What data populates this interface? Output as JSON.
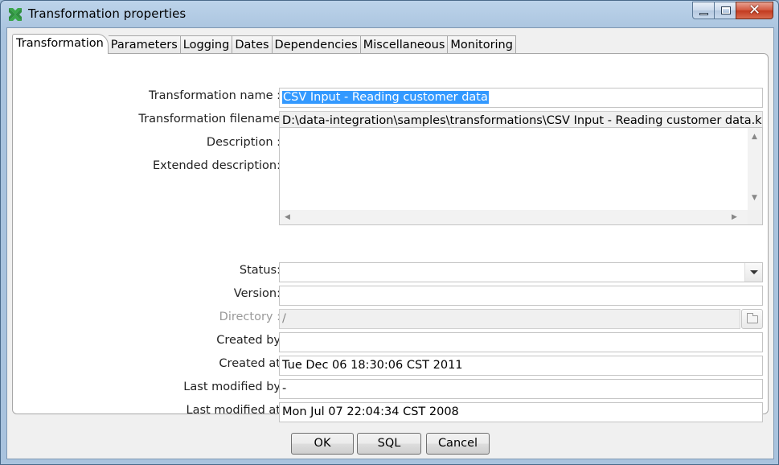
{
  "window": {
    "title": "Transformation properties"
  },
  "tabs": [
    {
      "label": "Transformation",
      "active": true
    },
    {
      "label": "Parameters"
    },
    {
      "label": "Logging"
    },
    {
      "label": "Dates"
    },
    {
      "label": "Dependencies"
    },
    {
      "label": "Miscellaneous"
    },
    {
      "label": "Monitoring"
    }
  ],
  "form": {
    "transformation_name": {
      "label": "Transformation name :",
      "value": "CSV Input - Reading customer data"
    },
    "transformation_filename": {
      "label": "Transformation filename",
      "value": "D:\\data-integration\\samples\\transformations\\CSV Input - Reading customer data.ktr"
    },
    "description": {
      "label": "Description :",
      "value": ""
    },
    "extended_description": {
      "label": "Extended description:",
      "value": ""
    },
    "status": {
      "label": "Status:",
      "value": ""
    },
    "version": {
      "label": "Version:",
      "value": ""
    },
    "directory": {
      "label": "Directory :",
      "value": "/"
    },
    "created_by": {
      "label": "Created by",
      "value": ""
    },
    "created_at": {
      "label": "Created at",
      "value": "Tue Dec 06 18:30:06 CST 2011"
    },
    "last_modified_by": {
      "label": "Last modified by",
      "value": "-"
    },
    "last_modified_at": {
      "label": "Last modified at",
      "value": "Mon Jul 07 22:04:34 CST 2008"
    }
  },
  "buttons": {
    "ok": "OK",
    "sql": "SQL",
    "cancel": "Cancel"
  },
  "glyphs": {
    "close": "✕",
    "scroll_up": "▲",
    "scroll_down": "▼",
    "scroll_left": "◀",
    "scroll_right": "▶"
  },
  "icons": {
    "app": "pentaho-spoon-icon",
    "browse": "folder-icon"
  }
}
